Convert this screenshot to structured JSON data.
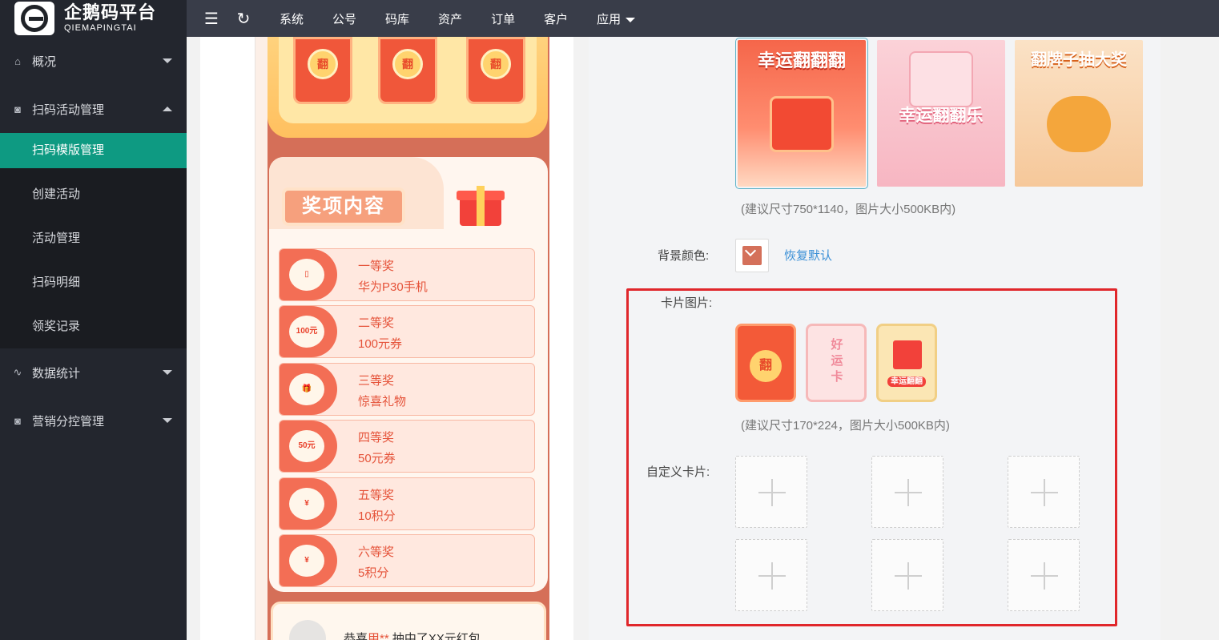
{
  "brand": {
    "name_cn": "企鹅码平台",
    "name_en": "QIEMAPINGTAI"
  },
  "topbar": {
    "items": [
      "系统",
      "公号",
      "码库",
      "资产",
      "订单",
      "客户",
      "应用"
    ]
  },
  "sidebar": {
    "groups": [
      {
        "label": "概况"
      },
      {
        "label": "扫码活动管理",
        "sub": [
          "扫码模版管理",
          "创建活动",
          "活动管理",
          "扫码明细",
          "领奖记录"
        ]
      },
      {
        "label": "数据统计"
      },
      {
        "label": "营销分控管理"
      }
    ]
  },
  "preview": {
    "card_char": "翻",
    "section_title": "奖项内容",
    "prizes": [
      {
        "level": "一等奖",
        "name": "华为P30手机",
        "icon": "phone-icon"
      },
      {
        "level": "二等奖",
        "name": "100元券",
        "icon": "coupon-icon",
        "badge": "100元"
      },
      {
        "level": "三等奖",
        "name": "惊喜礼物",
        "icon": "gift-icon"
      },
      {
        "level": "四等奖",
        "name": "50元券",
        "icon": "coupon-icon",
        "badge": "50元"
      },
      {
        "level": "五等奖",
        "name": "10积分",
        "icon": "coin-icon"
      },
      {
        "level": "六等奖",
        "name": "5积分",
        "icon": "coin-icon"
      }
    ],
    "winner": {
      "prefix": "恭喜",
      "name": "甲**",
      "suffix": " 抽中了XX元红包"
    }
  },
  "settings": {
    "bg_thumbs": [
      "幸运翻翻翻",
      "幸运翻翻乐",
      "翻牌子抽大奖"
    ],
    "bg_hint": "(建议尺寸750*1140，图片大小500KB内)",
    "bg_color_label": "背景颜色:",
    "bg_color_value": "#d4705a",
    "restore_label": "恢复默认",
    "card_label": "卡片图片:",
    "card_thumbs": [
      "翻",
      "好运卡",
      "幸运翻翻"
    ],
    "card_hint": "(建议尺寸170*224，图片大小500KB内)",
    "custom_label": "自定义卡片:"
  }
}
